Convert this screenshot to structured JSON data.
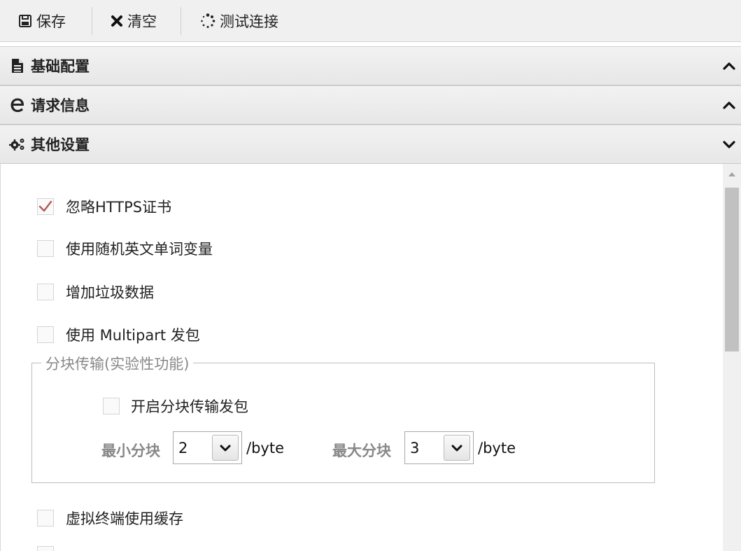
{
  "toolbar": {
    "save_label": "保存",
    "clear_label": "清空",
    "test_label": "测试连接"
  },
  "panels": [
    {
      "title": "基础配置",
      "icon": "document-icon",
      "state": "collapsed"
    },
    {
      "title": "请求信息",
      "icon": "browser-e-icon",
      "state": "collapsed"
    },
    {
      "title": "其他设置",
      "icon": "gears-icon",
      "state": "expanded"
    }
  ],
  "options": {
    "ignore_https": {
      "label": "忽略HTTPS证书",
      "checked": true
    },
    "random_words": {
      "label": "使用随机英文单词变量",
      "checked": false
    },
    "junk_data": {
      "label": "增加垃圾数据",
      "checked": false
    },
    "multipart": {
      "label": "使用 Multipart 发包",
      "checked": false
    },
    "terminal_cache": {
      "label": "虚拟终端使用缓存",
      "checked": false
    }
  },
  "chunked": {
    "legend": "分块传输(实验性功能)",
    "enable_label": "开启分块传输发包",
    "enable_checked": false,
    "min_label": "最小分块",
    "min_value": "2",
    "max_label": "最大分块",
    "max_value": "3",
    "unit": "/byte"
  },
  "colors": {
    "checkmark": "#b05a5a",
    "header_bg": "#ececec",
    "legend_text": "#888888"
  }
}
